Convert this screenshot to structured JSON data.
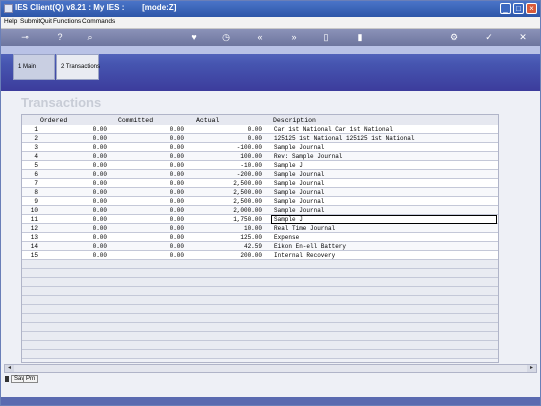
{
  "window": {
    "title": "IES Client(Q) v8.21 : My IES :        [mode:Z]"
  },
  "menu": {
    "items": [
      "Help",
      "Submit",
      "Quit",
      "Functions",
      "Commands"
    ]
  },
  "toolbar": {
    "icons": [
      "key-icon",
      "help-icon",
      "search-icon",
      "heart-icon",
      "clock-icon",
      "rewind-icon",
      "fast-forward-icon",
      "copy-icon",
      "trash-icon",
      "settings-icon",
      "check-icon",
      "close-icon"
    ]
  },
  "tabs": [
    {
      "label": "1 Main"
    },
    {
      "label": "2 Transactions"
    }
  ],
  "page": {
    "title": "Transactions"
  },
  "table": {
    "headers": {
      "ordered": "Ordered",
      "committed": "Committed",
      "actual": "Actual",
      "description": "Description"
    },
    "rows": [
      {
        "num": "1",
        "ordered": "0.00",
        "committed": "0.00",
        "actual": "0.00",
        "description": "Car 1st National Car 1st National"
      },
      {
        "num": "2",
        "ordered": "0.00",
        "committed": "0.00",
        "actual": "0.00",
        "description": "125125 1st National 125125 1st National"
      },
      {
        "num": "3",
        "ordered": "0.00",
        "committed": "0.00",
        "actual": "-100.00",
        "description": "Sample Journal"
      },
      {
        "num": "4",
        "ordered": "0.00",
        "committed": "0.00",
        "actual": "100.00",
        "description": "Rev: Sample Journal"
      },
      {
        "num": "5",
        "ordered": "0.00",
        "committed": "0.00",
        "actual": "-10.00",
        "description": "Sample J"
      },
      {
        "num": "6",
        "ordered": "0.00",
        "committed": "0.00",
        "actual": "-200.00",
        "description": "Sample Journal"
      },
      {
        "num": "7",
        "ordered": "0.00",
        "committed": "0.00",
        "actual": "2,500.00",
        "description": "Sample Journal"
      },
      {
        "num": "8",
        "ordered": "0.00",
        "committed": "0.00",
        "actual": "2,500.00",
        "description": "Sample Journal"
      },
      {
        "num": "9",
        "ordered": "0.00",
        "committed": "0.00",
        "actual": "2,500.00",
        "description": "Sample Journal"
      },
      {
        "num": "10",
        "ordered": "0.00",
        "committed": "0.00",
        "actual": "2,000.00",
        "description": "Sample Journal"
      },
      {
        "num": "11",
        "ordered": "0.00",
        "committed": "0.00",
        "actual": "1,750.00",
        "description": "Sample J"
      },
      {
        "num": "12",
        "ordered": "0.00",
        "committed": "0.00",
        "actual": "10.00",
        "description": "Real Time Journal"
      },
      {
        "num": "13",
        "ordered": "0.00",
        "committed": "0.00",
        "actual": "125.00",
        "description": "Expense"
      },
      {
        "num": "14",
        "ordered": "0.00",
        "committed": "0.00",
        "actual": "42.59",
        "description": "Eikon En-ell Battery"
      },
      {
        "num": "15",
        "ordered": "0.00",
        "committed": "0.00",
        "actual": "200.00",
        "description": "Internal Recovery"
      }
    ],
    "selected_row": "11"
  },
  "statusbar": {
    "buttons": [
      "Sav",
      "Prn"
    ]
  },
  "colors": {
    "titlebar": "#3a62b8",
    "tab_band": "#4655b0",
    "toolbar": "#7b83ab"
  }
}
